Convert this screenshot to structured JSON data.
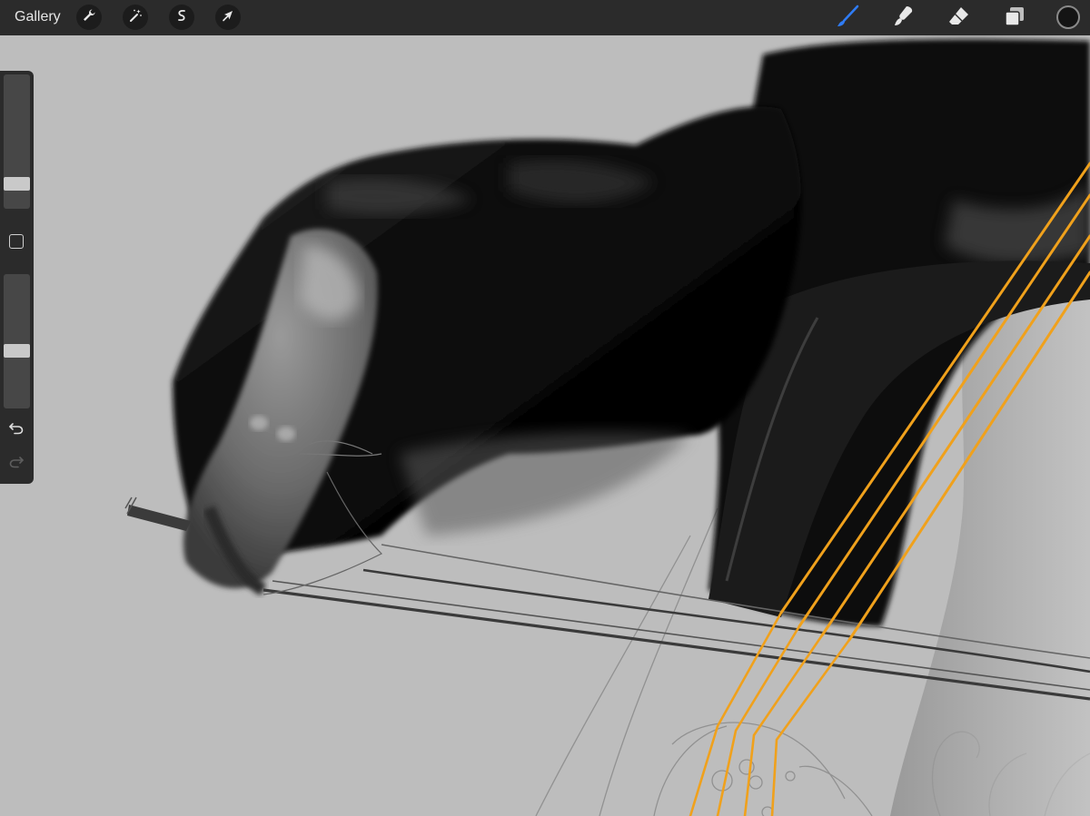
{
  "toolbar": {
    "gallery_label": "Gallery",
    "left_tools": [
      {
        "name": "actions",
        "icon": "wrench-icon"
      },
      {
        "name": "adjustments",
        "icon": "magic-wand-icon"
      },
      {
        "name": "selection",
        "icon": "selection-s-icon"
      },
      {
        "name": "transform",
        "icon": "arrow-cursor-icon"
      }
    ],
    "right_tools": [
      {
        "name": "brush",
        "icon": "brush-icon",
        "active": true
      },
      {
        "name": "smudge",
        "icon": "smudge-icon",
        "active": false
      },
      {
        "name": "eraser",
        "icon": "eraser-icon",
        "active": false
      },
      {
        "name": "layers",
        "icon": "layers-icon",
        "active": false
      }
    ],
    "current_color": "#141414",
    "accent_color": "#2f7cf6"
  },
  "sidebar": {
    "brush_size_level": 0.15,
    "opacity_level": 0.42,
    "modify_button_icon": "square-icon",
    "undo_icon": "undo-icon",
    "redo_icon": "redo-icon",
    "redo_enabled": false
  },
  "canvas": {
    "background_color": "#bdbdbd",
    "string_color": "#f0a11c"
  }
}
